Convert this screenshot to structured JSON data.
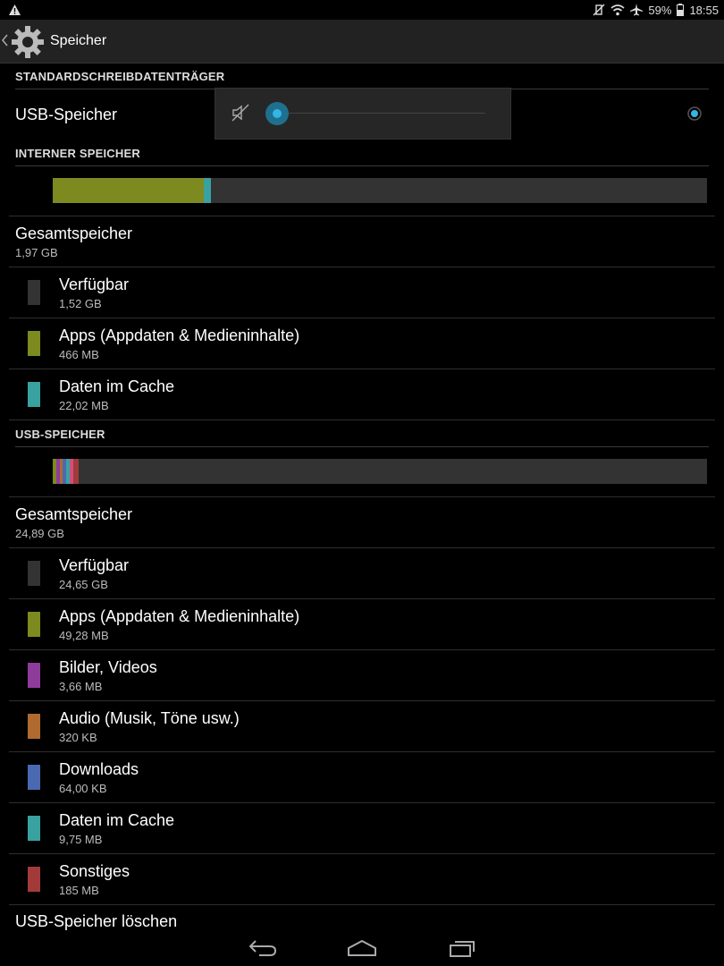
{
  "status_bar": {
    "warning_icon": "warning-icon",
    "battery": "59%",
    "time": "18:55"
  },
  "action_bar": {
    "title": "Speicher",
    "icon": "gear-icon"
  },
  "default_storage": {
    "header": "STANDARDSCHREIBDATENTRÄGER",
    "option_label": "USB-Speicher",
    "selected": true
  },
  "volume_popup": {
    "icon": "volume-muted-icon",
    "level": 0
  },
  "internal": {
    "header": "INTERNER SPEICHER",
    "usage_bar": [
      {
        "name": "Apps",
        "fraction": 0.231,
        "color": "#7d8a1f"
      },
      {
        "name": "Cache",
        "fraction": 0.011,
        "color": "#3aa1a1"
      }
    ],
    "total_label": "Gesamtspeicher",
    "total_value": "1,97 GB",
    "items": [
      {
        "label": "Verfügbar",
        "value": "1,52 GB",
        "color": "#333333"
      },
      {
        "label": "Apps (Appdaten & Medieninhalte)",
        "value": "466 MB",
        "color": "#7d8a1f"
      },
      {
        "label": "Daten im Cache",
        "value": "22,02 MB",
        "color": "#3aa1a1"
      }
    ]
  },
  "usb": {
    "header": "USB-SPEICHER",
    "usage_bar": [
      {
        "name": "Apps",
        "fraction": 0.005,
        "color": "#7d8a1f"
      },
      {
        "name": "Bilder",
        "fraction": 0.006,
        "color": "#8e3c9c"
      },
      {
        "name": "Audio",
        "fraction": 0.004,
        "color": "#b06a30"
      },
      {
        "name": "Downloads",
        "fraction": 0.006,
        "color": "#4a69b0"
      },
      {
        "name": "Cache",
        "fraction": 0.006,
        "color": "#3aa1a1"
      },
      {
        "name": "Extra",
        "fraction": 0.005,
        "color": "#d04f7c"
      },
      {
        "name": "Sonstiges",
        "fraction": 0.008,
        "color": "#a33a3a"
      }
    ],
    "total_label": "Gesamtspeicher",
    "total_value": "24,89 GB",
    "items": [
      {
        "label": "Verfügbar",
        "value": "24,65 GB",
        "color": "#333333"
      },
      {
        "label": "Apps (Appdaten & Medieninhalte)",
        "value": "49,28 MB",
        "color": "#7d8a1f"
      },
      {
        "label": "Bilder, Videos",
        "value": "3,66 MB",
        "color": "#8e3c9c"
      },
      {
        "label": "Audio (Musik, Töne usw.)",
        "value": "320 KB",
        "color": "#b06a30"
      },
      {
        "label": "Downloads",
        "value": "64,00 KB",
        "color": "#4a69b0"
      },
      {
        "label": "Daten im Cache",
        "value": "9,75 MB",
        "color": "#3aa1a1"
      },
      {
        "label": "Sonstiges",
        "value": "185 MB",
        "color": "#a33a3a"
      }
    ],
    "erase_label": "USB-Speicher löschen"
  },
  "nav_bar": {
    "back": "back-icon",
    "home": "home-icon",
    "recents": "recents-icon"
  }
}
